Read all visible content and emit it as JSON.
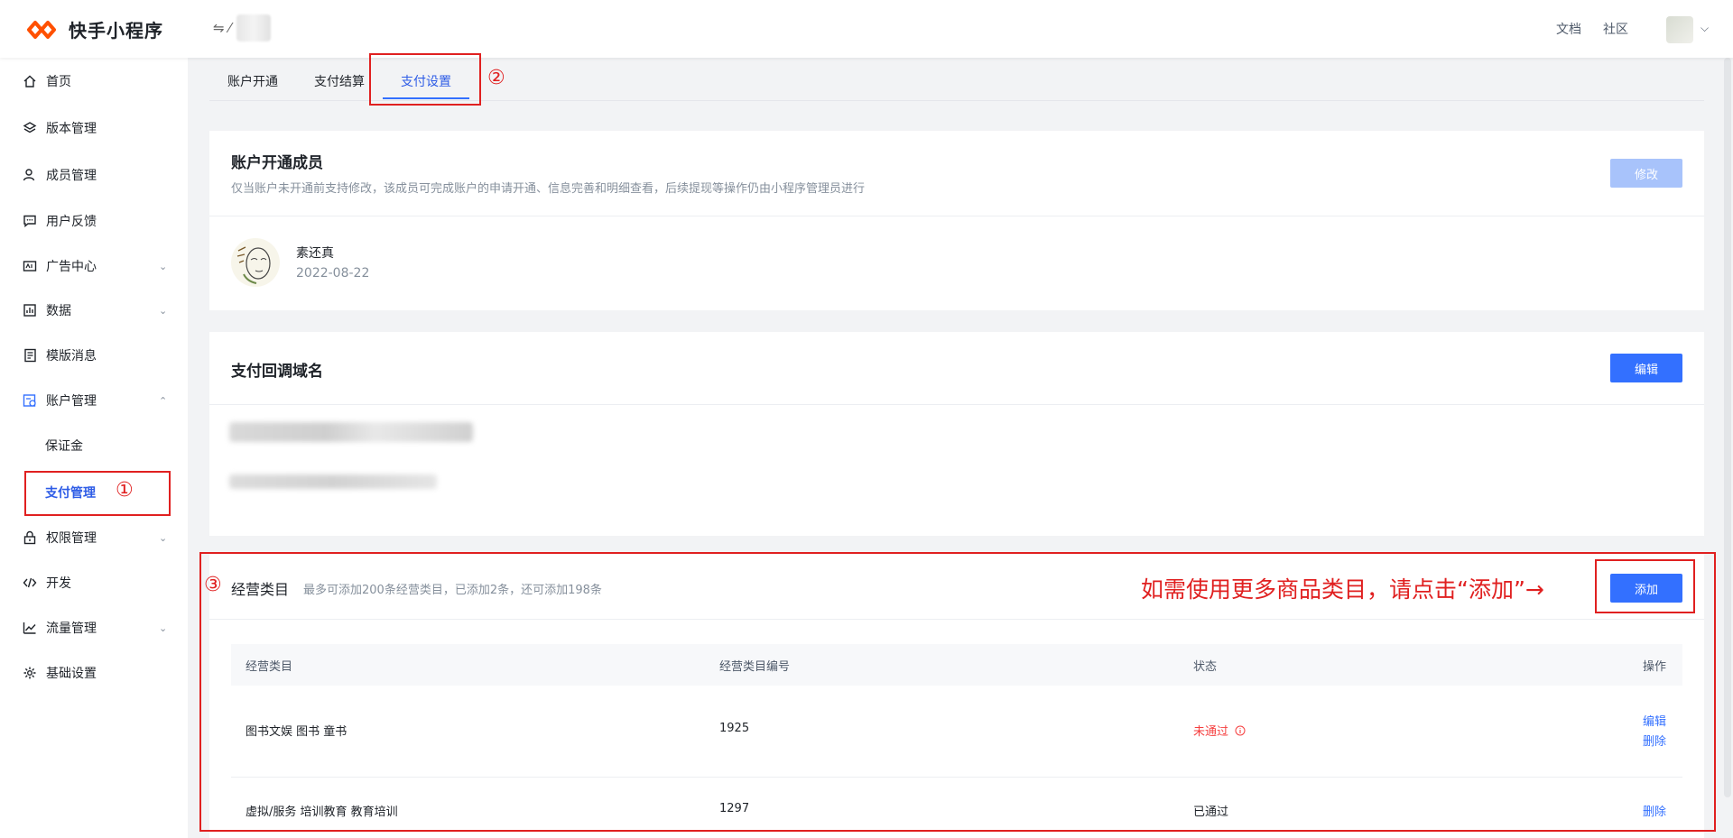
{
  "header": {
    "logo_text": "快手小程序",
    "switch_glyph": "⇋ ⁄",
    "links": [
      "文档",
      "社区"
    ],
    "icons": {
      "logo": "kuaishou-logo",
      "avatar": "user-avatar",
      "chevron": "chevron-down-icon"
    }
  },
  "sidebar": {
    "items": [
      {
        "label": "首页",
        "icon": "home-icon"
      },
      {
        "label": "版本管理",
        "icon": "layers-icon"
      },
      {
        "label": "成员管理",
        "icon": "user-icon"
      },
      {
        "label": "用户反馈",
        "icon": "message-icon"
      },
      {
        "label": "广告中心",
        "icon": "ad-icon"
      },
      {
        "label": "数据",
        "icon": "chart-icon"
      },
      {
        "label": "模版消息",
        "icon": "template-icon"
      },
      {
        "label": "账户管理",
        "icon": "account-icon"
      },
      {
        "label": "保证金",
        "icon": ""
      },
      {
        "label": "支付管理",
        "icon": ""
      },
      {
        "label": "权限管理",
        "icon": "lock-icon"
      },
      {
        "label": "开发",
        "icon": "code-icon"
      },
      {
        "label": "流量管理",
        "icon": "trend-icon"
      },
      {
        "label": "基础设置",
        "icon": "gear-icon"
      }
    ]
  },
  "annotations": {
    "num1": "①",
    "num2": "②",
    "num3": "③",
    "hint": "如需使用更多商品类目，请点击“添加”→"
  },
  "tabs": [
    "账户开通",
    "支付结算",
    "支付设置"
  ],
  "member_card": {
    "title": "账户开通成员",
    "desc": "仅当账户未开通前支持修改，该成员可完成账户的申请开通、信息完善和明细查看，后续提现等操作仍由小程序管理员进行",
    "edit_button": "修改",
    "member_name": "素还真",
    "member_date": "2022-08-22"
  },
  "callback_card": {
    "title": "支付回调域名",
    "edit_button": "编辑"
  },
  "category_card": {
    "title": "经营类目",
    "note": "最多可添加200条经营类目，已添加2条，还可添加198条",
    "add_button": "添加",
    "columns": [
      "经营类目",
      "经营类目编号",
      "状态",
      "操作"
    ],
    "rows": [
      {
        "category": "图书文娱 图书 童书",
        "code": "1925",
        "status": "未通过",
        "status_icon": "info-circle-icon",
        "actions": [
          "编辑",
          "删除"
        ]
      },
      {
        "category": "虚拟/服务 培训教育 教育培训",
        "code": "1297",
        "status": "已通过",
        "actions": [
          "删除"
        ]
      }
    ]
  },
  "colors": {
    "primary": "#3370ff",
    "annotation_red": "#e02020",
    "fail_red": "#f53f3f"
  }
}
